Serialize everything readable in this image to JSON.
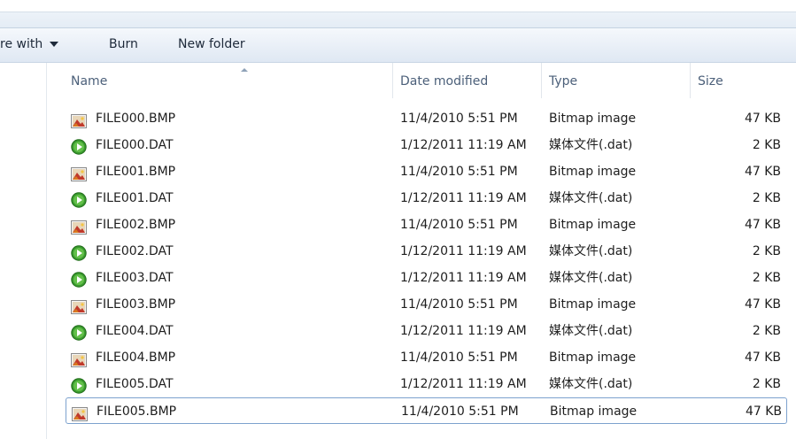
{
  "toolbar": {
    "share_label": "re with",
    "burn_label": "Burn",
    "new_folder_label": "New folder"
  },
  "columns": {
    "name": "Name",
    "date": "Date modified",
    "type": "Type",
    "size": "Size"
  },
  "files": [
    {
      "name": "FILE000.BMP",
      "date": "11/4/2010 5:51 PM",
      "type": "Bitmap image",
      "size": "47 KB",
      "icon": "bitmap-icon"
    },
    {
      "name": "FILE000.DAT",
      "date": "1/12/2011 11:19 AM",
      "type": "媒体文件(.dat)",
      "size": "2 KB",
      "icon": "media-file-icon"
    },
    {
      "name": "FILE001.BMP",
      "date": "11/4/2010 5:51 PM",
      "type": "Bitmap image",
      "size": "47 KB",
      "icon": "bitmap-icon"
    },
    {
      "name": "FILE001.DAT",
      "date": "1/12/2011 11:19 AM",
      "type": "媒体文件(.dat)",
      "size": "2 KB",
      "icon": "media-file-icon"
    },
    {
      "name": "FILE002.BMP",
      "date": "11/4/2010 5:51 PM",
      "type": "Bitmap image",
      "size": "47 KB",
      "icon": "bitmap-icon"
    },
    {
      "name": "FILE002.DAT",
      "date": "1/12/2011 11:19 AM",
      "type": "媒体文件(.dat)",
      "size": "2 KB",
      "icon": "media-file-icon"
    },
    {
      "name": "FILE003.DAT",
      "date": "1/12/2011 11:19 AM",
      "type": "媒体文件(.dat)",
      "size": "2 KB",
      "icon": "media-file-icon"
    },
    {
      "name": "FILE003.BMP",
      "date": "11/4/2010 5:51 PM",
      "type": "Bitmap image",
      "size": "47 KB",
      "icon": "bitmap-icon"
    },
    {
      "name": "FILE004.DAT",
      "date": "1/12/2011 11:19 AM",
      "type": "媒体文件(.dat)",
      "size": "2 KB",
      "icon": "media-file-icon"
    },
    {
      "name": "FILE004.BMP",
      "date": "11/4/2010 5:51 PM",
      "type": "Bitmap image",
      "size": "47 KB",
      "icon": "bitmap-icon"
    },
    {
      "name": "FILE005.DAT",
      "date": "1/12/2011 11:19 AM",
      "type": "媒体文件(.dat)",
      "size": "2 KB",
      "icon": "media-file-icon"
    },
    {
      "name": "FILE005.BMP",
      "date": "11/4/2010 5:51 PM",
      "type": "Bitmap image",
      "size": "47 KB",
      "icon": "bitmap-icon",
      "selected": true
    }
  ]
}
